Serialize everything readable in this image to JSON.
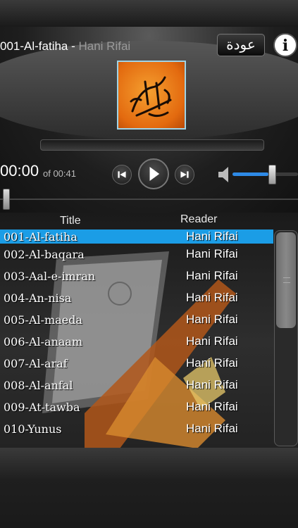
{
  "now_playing": {
    "track_name": "001-Al-fatiha - ",
    "reader": "Hani Rifai",
    "time_current": "00:00",
    "time_total": "of 00:41",
    "progress": 0,
    "volume": 0.55
  },
  "buttons": {
    "back_label": "عودة",
    "info_label": "i"
  },
  "list": {
    "header_title": "Title",
    "header_reader": "Reader",
    "rows": [
      {
        "title": "001-Al-fatiha",
        "reader": "Hani Rifai"
      },
      {
        "title": "002-Al-baqara",
        "reader": "Hani Rifai"
      },
      {
        "title": "003-Aal-e-imran",
        "reader": "Hani Rifai"
      },
      {
        "title": "004-An-nisa",
        "reader": "Hani Rifai"
      },
      {
        "title": "005-Al-maeda",
        "reader": "Hani Rifai"
      },
      {
        "title": "006-Al-anaam",
        "reader": "Hani Rifai"
      },
      {
        "title": "007-Al-araf",
        "reader": "Hani Rifai"
      },
      {
        "title": "008-Al-anfal",
        "reader": "Hani Rifai"
      },
      {
        "title": "009-At-tawba",
        "reader": "Hani Rifai"
      },
      {
        "title": "010-Yunus",
        "reader": "Hani Rifai"
      }
    ],
    "selected_index": 0
  },
  "colors": {
    "selection": "#1b9de6",
    "volume_fill": "#2e8ae6",
    "cover_orange": "#e36a0f"
  },
  "icons": {
    "prev": "skip-previous-icon",
    "play": "play-icon",
    "next": "skip-next-icon",
    "volume": "speaker-icon",
    "info": "info-icon"
  }
}
